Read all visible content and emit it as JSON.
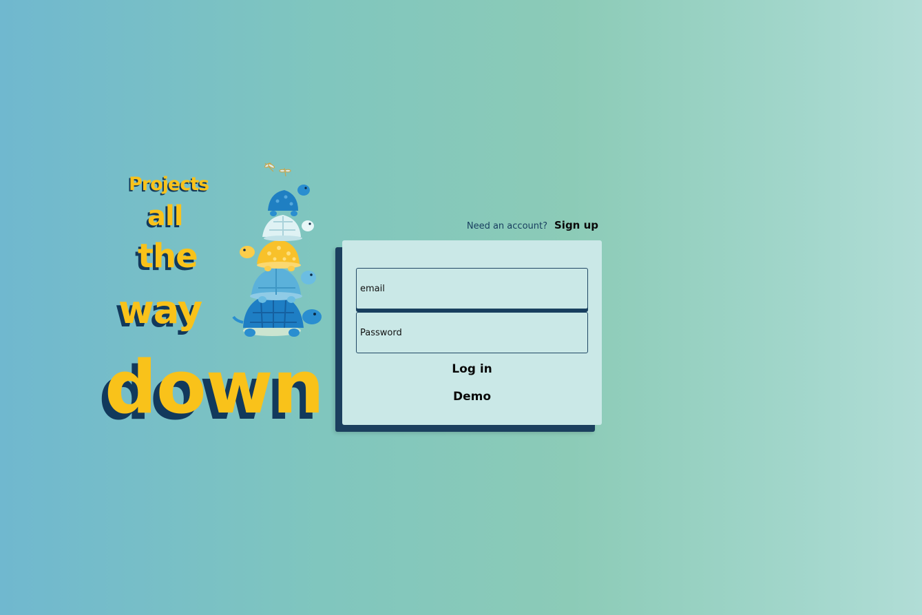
{
  "logo": {
    "words": [
      "Projects",
      "all",
      "the",
      "way",
      "down"
    ]
  },
  "auth": {
    "prompt": "Need an account?",
    "signup_label": "Sign up"
  },
  "login_form": {
    "email_placeholder": "email",
    "password_placeholder": "Password",
    "login_label": "Log in",
    "demo_label": "Demo"
  },
  "colors": {
    "accent_yellow": "#f9c21a",
    "navy": "#12395c",
    "card_bg": "#cae8e7"
  }
}
